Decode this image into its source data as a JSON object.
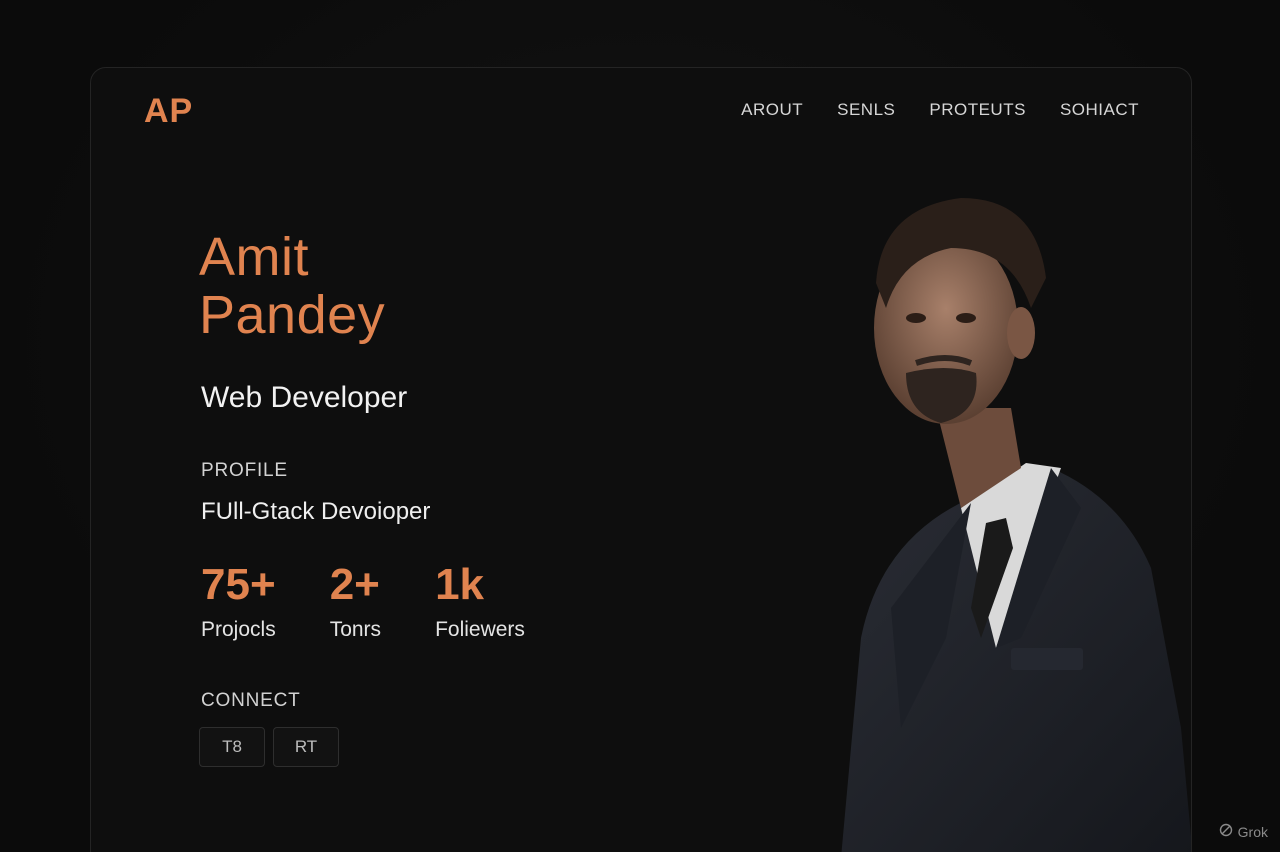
{
  "header": {
    "logo": "AP",
    "nav": [
      "AROUT",
      "SENLS",
      "PROTEUTS",
      "SOHIACT"
    ]
  },
  "hero": {
    "first_name": "Amit",
    "last_name": "Pandey",
    "role": "Web Developer"
  },
  "profile": {
    "label": "PROFILE",
    "text": "FUll-Gtack Devoioper"
  },
  "stats": [
    {
      "value": "75+",
      "label": "Projocls"
    },
    {
      "value": "2+",
      "label": "Tonrs"
    },
    {
      "value": "1k",
      "label": "Foliewers"
    }
  ],
  "connect": {
    "label": "CONNECT",
    "buttons": [
      "T8",
      "RT"
    ]
  },
  "watermark": "Grok",
  "colors": {
    "accent": "#e0834f",
    "background": "#0b0b0b",
    "card": "#0e0e0e",
    "text": "#f2f2f2"
  },
  "icons": {
    "watermark": "grok-logo-icon"
  }
}
